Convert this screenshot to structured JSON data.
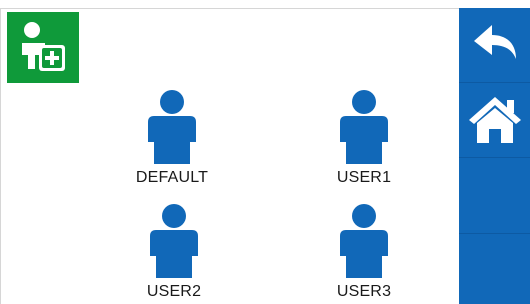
{
  "colors": {
    "accent_green": "#0f9a3a",
    "sidebar_blue": "#1168b8",
    "user_icon_blue": "#1168b8"
  },
  "toolbar": {
    "add_user_icon": "add-user-icon"
  },
  "sidebar": {
    "back_icon": "back-arrow-icon",
    "home_icon": "home-icon"
  },
  "users": [
    {
      "label": "DEFAULT"
    },
    {
      "label": "USER1"
    },
    {
      "label": "USER2"
    },
    {
      "label": "USER3"
    }
  ]
}
